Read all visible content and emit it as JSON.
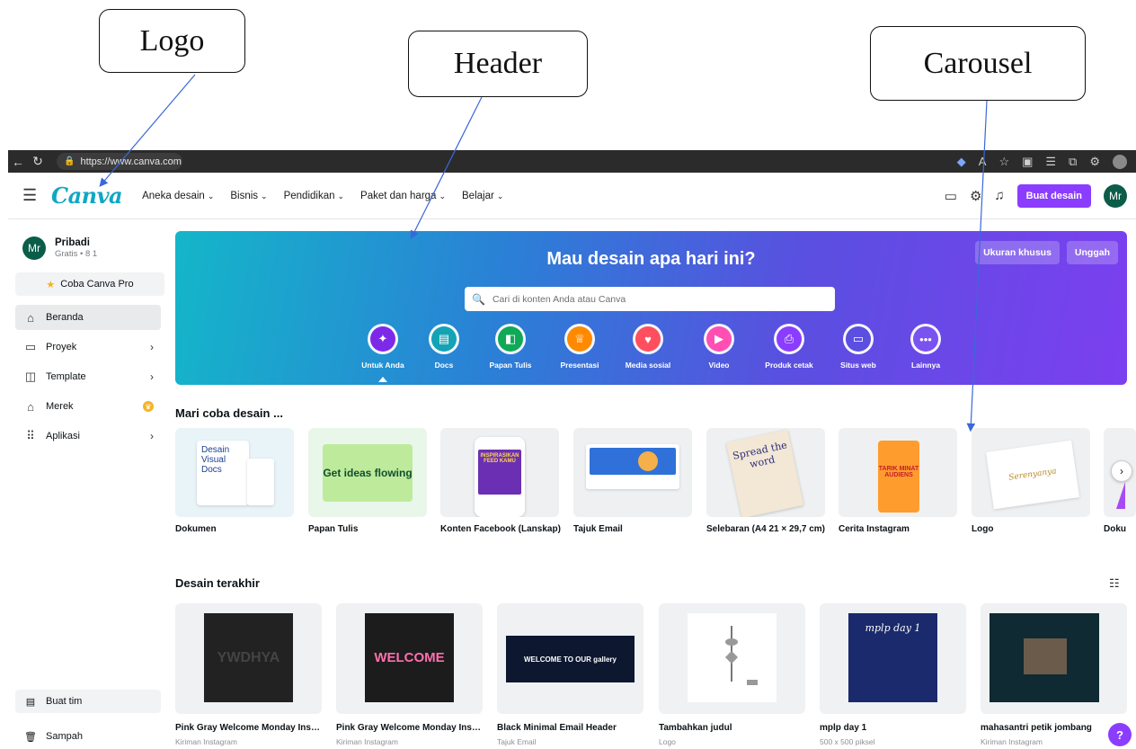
{
  "annotations": {
    "logo": "Logo",
    "header": "Header",
    "carousel": "Carousel"
  },
  "browser": {
    "url": "https://www.canva.com",
    "icons": [
      "back-icon",
      "reload-icon",
      "lock-icon",
      "tag-icon",
      "read-aloud-icon",
      "star-icon",
      "split-icon",
      "favorites-icon",
      "collections-icon",
      "extensions-icon",
      "profile-icon"
    ]
  },
  "nav": {
    "logo_text": "Canva",
    "menu": [
      "Aneka desain",
      "Bisnis",
      "Pendidikan",
      "Paket dan harga",
      "Belajar"
    ],
    "create_button": "Buat desain",
    "avatar": "Mr",
    "icons": [
      "menu-icon",
      "desktop-icon",
      "settings-icon",
      "bell-icon"
    ]
  },
  "sidebar": {
    "avatar": "Mr",
    "user_name": "Pribadi",
    "user_sub": "Gratis • 8 1",
    "try_pro": "Coba Canva Pro",
    "items": [
      {
        "label": "Beranda",
        "icon": "home-icon",
        "active": true
      },
      {
        "label": "Proyek",
        "icon": "folder-icon"
      },
      {
        "label": "Template",
        "icon": "template-icon"
      },
      {
        "label": "Merek",
        "icon": "brand-icon"
      },
      {
        "label": "Aplikasi",
        "icon": "apps-icon"
      }
    ],
    "team": "Buat tim",
    "trash": "Sampah"
  },
  "hero": {
    "title": "Mau desain apa hari ini?",
    "custom_size": "Ukuran khusus",
    "upload": "Unggah",
    "search_placeholder": "Cari di konten Anda atau Canva",
    "categories": [
      {
        "label": "Untuk Anda",
        "color": "#7d2ae8",
        "icon": "sparkle-icon"
      },
      {
        "label": "Docs",
        "color": "#13a3b5",
        "icon": "docs-icon"
      },
      {
        "label": "Papan Tulis",
        "color": "#0fa958",
        "icon": "whiteboard-icon"
      },
      {
        "label": "Presentasi",
        "color": "#ff8a00",
        "icon": "presentation-icon"
      },
      {
        "label": "Media sosial",
        "color": "#ff4f5e",
        "icon": "heart-icon"
      },
      {
        "label": "Video",
        "color": "#ff4fb3",
        "icon": "video-icon"
      },
      {
        "label": "Produk cetak",
        "color": "#8b3dff",
        "icon": "print-icon"
      },
      {
        "label": "Situs web",
        "color": "#5a4fe0",
        "icon": "website-icon"
      },
      {
        "label": "Lainnya",
        "color": "#7a52f0",
        "icon": "more-icon"
      }
    ]
  },
  "try_section": {
    "title": "Mari coba desain ...",
    "items": [
      {
        "label": "Dokumen",
        "thumb_text": "Desain Visual Docs"
      },
      {
        "label": "Papan Tulis",
        "thumb_text": "Get ideas flowing"
      },
      {
        "label": "Konten Facebook (Lanskap)",
        "thumb_text": "INSPIRASIKAN FEED KAMU"
      },
      {
        "label": "Tajuk Email",
        "thumb_text": ""
      },
      {
        "label": "Selebaran (A4 21 × 29,7 cm)",
        "thumb_text": "Spread the word"
      },
      {
        "label": "Cerita Instagram",
        "thumb_text": "TARIK MINAT AUDIENS"
      },
      {
        "label": "Logo",
        "thumb_text": "Serenyanya"
      },
      {
        "label": "Doku",
        "thumb_text": ""
      }
    ]
  },
  "recent_section": {
    "title": "Desain terakhir",
    "items": [
      {
        "title": "Pink Gray Welcome Monday Insta...",
        "sub": "Kiriman Instagram",
        "thumb_text": "YWDHYA"
      },
      {
        "title": "Pink Gray Welcome Monday Insta...",
        "sub": "Kiriman Instagram",
        "thumb_text": "WELCOME"
      },
      {
        "title": "Black Minimal Email Header",
        "sub": "Tajuk Email",
        "thumb_text": "WELCOME TO OUR gallery"
      },
      {
        "title": "Tambahkan judul",
        "sub": "Logo",
        "thumb_text": ""
      },
      {
        "title": "mplp day 1",
        "sub": "500 x 500 piksel",
        "thumb_text": "mplp day 1"
      },
      {
        "title": "mahasantri petik jombang",
        "sub": "Kiriman Instagram",
        "thumb_text": ""
      }
    ]
  },
  "help": "?"
}
